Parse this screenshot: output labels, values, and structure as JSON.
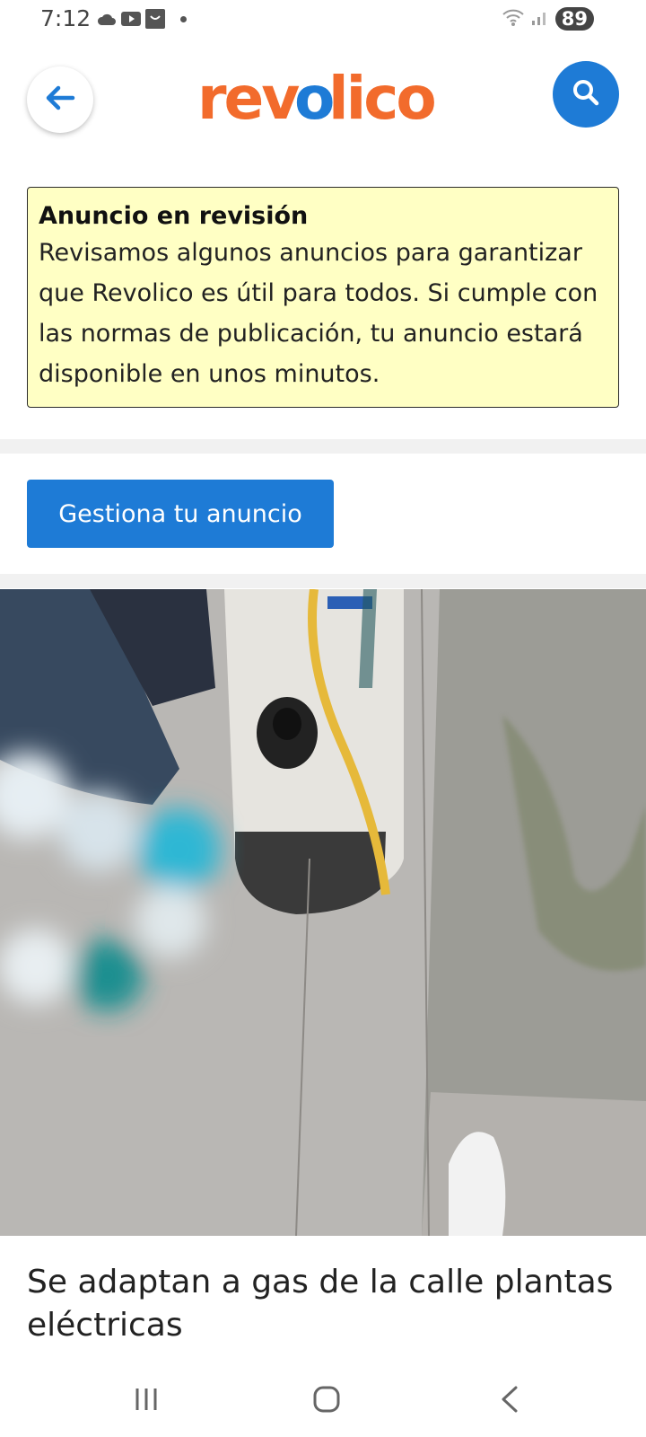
{
  "status_bar": {
    "time": "7:12",
    "battery": "89",
    "icons": [
      "cloud-icon",
      "youtube-icon",
      "app-icon",
      "notification-dot-icon",
      "wifi-icon",
      "signal-icon"
    ]
  },
  "header": {
    "logo_text": "revolico",
    "back_icon": "arrow-left-icon",
    "search_icon": "search-icon",
    "colors": {
      "logo_orange": "#f26b2c",
      "logo_blue": "#1e7bd6",
      "accent": "#1e7bd6"
    }
  },
  "notice": {
    "title": "Anuncio en revisión",
    "body": "Revisamos algunos anuncios para garantizar que Revolico es útil para todos. Si cumple con las normas de publicación, tu anuncio estará disponible en unos minutos."
  },
  "manage_button": {
    "label": "Gestiona tu anuncio"
  },
  "ad": {
    "title": "Se adaptan a gas de la calle plantas eléctricas"
  },
  "navbar": {
    "icons": [
      "recent-apps-icon",
      "home-icon",
      "back-nav-icon"
    ]
  }
}
